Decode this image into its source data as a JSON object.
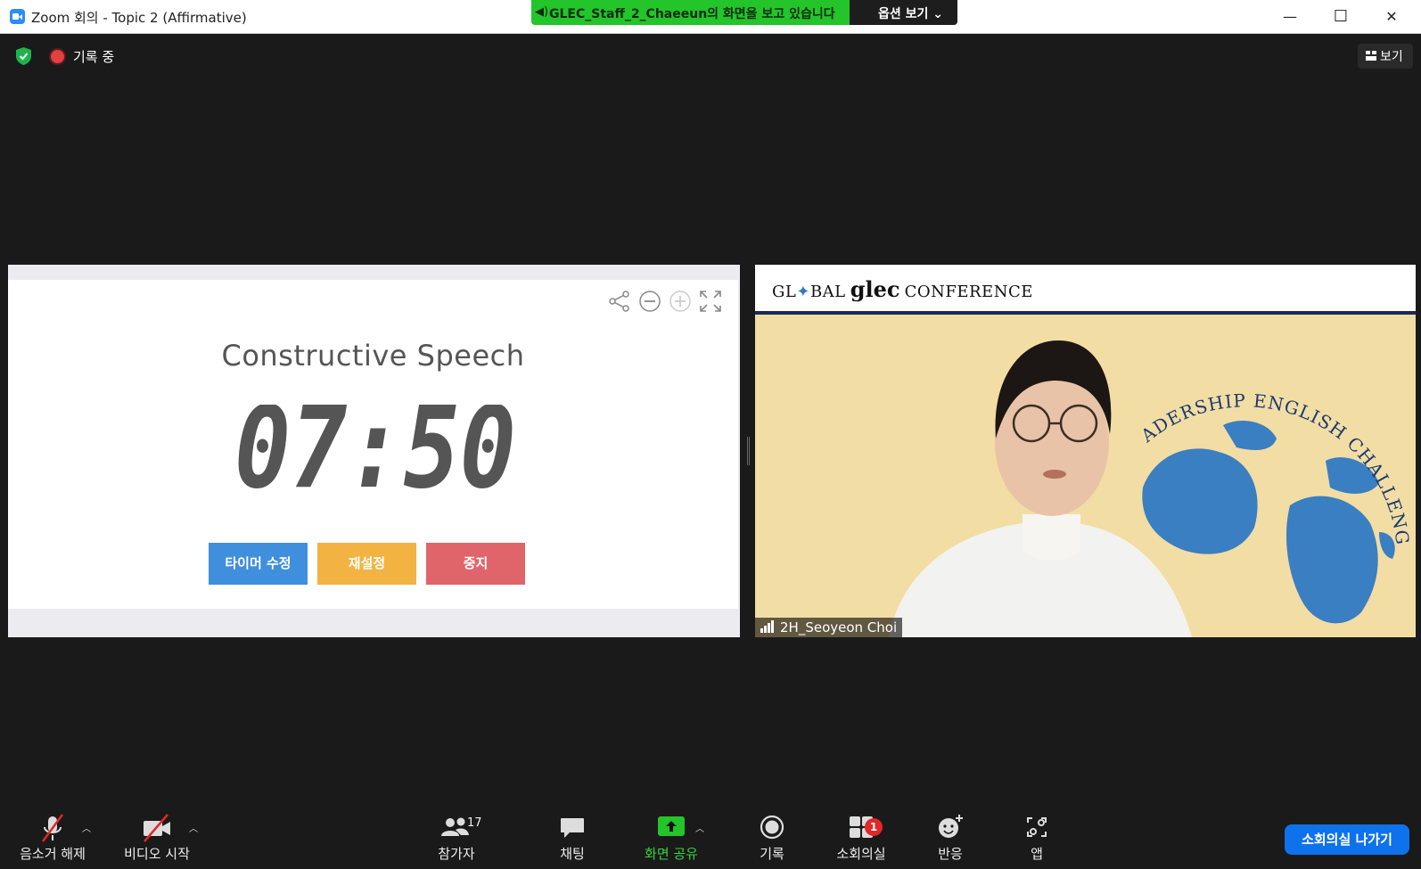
{
  "window": {
    "title": "Zoom 회의 - Topic 2 (Affirmative)",
    "controls": {
      "minimize": "—",
      "maximize": "☐",
      "close": "✕"
    }
  },
  "share_banner": {
    "text": "GLEC_Staff_2_Chaeeun의 화면을 보고 있습니다",
    "options_label": "옵션 보기 ⌄",
    "color": "#24c42b"
  },
  "status": {
    "recording_label": "기록 중",
    "view_label": "보기"
  },
  "timer": {
    "title": "Constructive Speech",
    "time": "07:50",
    "buttons": {
      "edit": "타이머 수정",
      "reset": "재설정",
      "stop": "중지"
    },
    "colors": {
      "edit": "#3f8fdc",
      "reset": "#f2b342",
      "stop": "#e0656b",
      "digits": "#555555"
    }
  },
  "video": {
    "header_global": "GL",
    "header_bal": "BAL",
    "header_glec": "glec",
    "header_conference": "CONFERENCE",
    "backdrop_text": "ADERSHIP ENGLISH CHALLENGE",
    "participant_name": "2H_Seoyeon Choi"
  },
  "toolbar": {
    "unmute": "음소거 해제",
    "start_video": "비디오 시작",
    "participants": "참가자",
    "participants_count": "17",
    "chat": "채팅",
    "share_screen": "화면 공유",
    "record": "기록",
    "breakout_rooms": "소회의실",
    "breakout_badge": "1",
    "reactions": "반응",
    "apps": "앱",
    "leave_breakout": "소회의실 나가기"
  }
}
